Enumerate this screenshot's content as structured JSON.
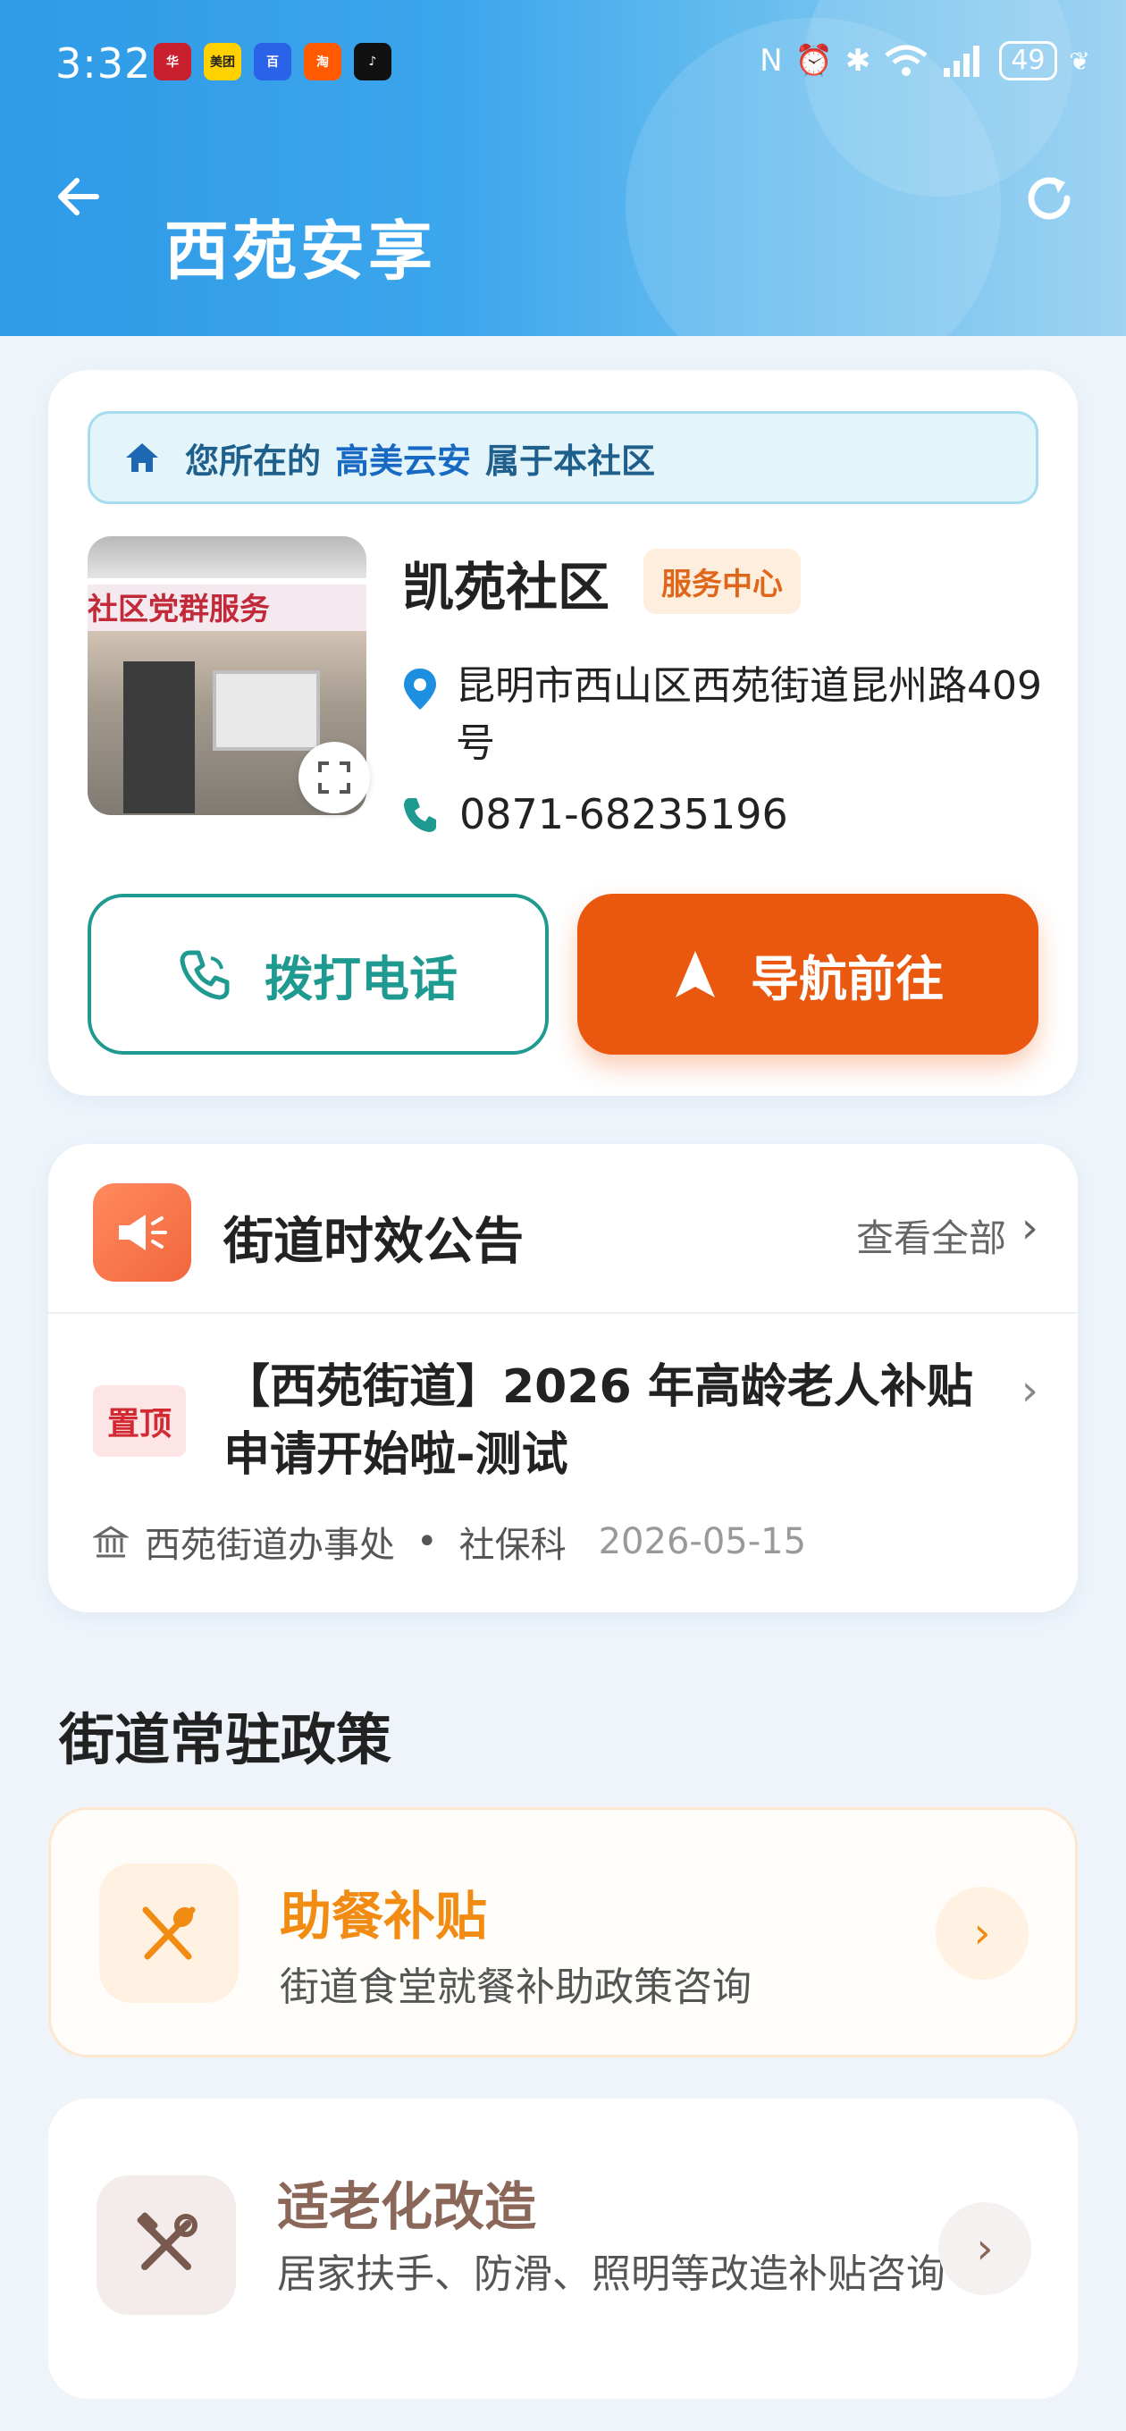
{
  "status_bar": {
    "time": "3:32",
    "app_icons": [
      {
        "name": "huawei-app-icon",
        "label": "华",
        "color": "#c8202e"
      },
      {
        "name": "meituan-app-icon",
        "label": "美团",
        "color": "#ffd100"
      },
      {
        "name": "baidu-app-icon",
        "label": "百",
        "color": "#2a62e8"
      },
      {
        "name": "taobao-app-icon",
        "label": "淘",
        "color": "#ff5a00"
      },
      {
        "name": "tiktok-app-icon",
        "label": "♪",
        "color": "#111111"
      }
    ],
    "battery": "49"
  },
  "header": {
    "title": "西苑安享"
  },
  "community": {
    "belong_prefix": "您所在的",
    "belong_place": "高美云安",
    "belong_suffix": "属于本社区",
    "name": "凯苑社区",
    "tag": "服务中心",
    "photo_banner": "社区党群服务",
    "address": "昆明市西山区西苑街道昆州路409号",
    "phone": "0871-68235196",
    "call_label": "拨打电话",
    "nav_label": "导航前往"
  },
  "notice": {
    "title": "街道时效公告",
    "view_all": "查看全部",
    "pin_label": "置顶",
    "item_title": "【西苑街道】2026 年高龄老人补贴申请开始啦-测试",
    "source": "西苑街道办事处",
    "dept": "社保科",
    "date": "2026-05-15"
  },
  "policies": {
    "section_title": "街道常驻政策",
    "items": [
      {
        "title": "助餐补贴",
        "desc": "街道食堂就餐补助政策咨询"
      },
      {
        "title": "适老化改造",
        "desc": "居家扶手、防滑、照明等改造补贴咨询"
      }
    ]
  },
  "colors": {
    "primary_blue": "#3aa3ea",
    "teal": "#1e9a90",
    "orange": "#ea5810",
    "policy_orange": "#f18b12",
    "policy_brown": "#8a6758"
  }
}
